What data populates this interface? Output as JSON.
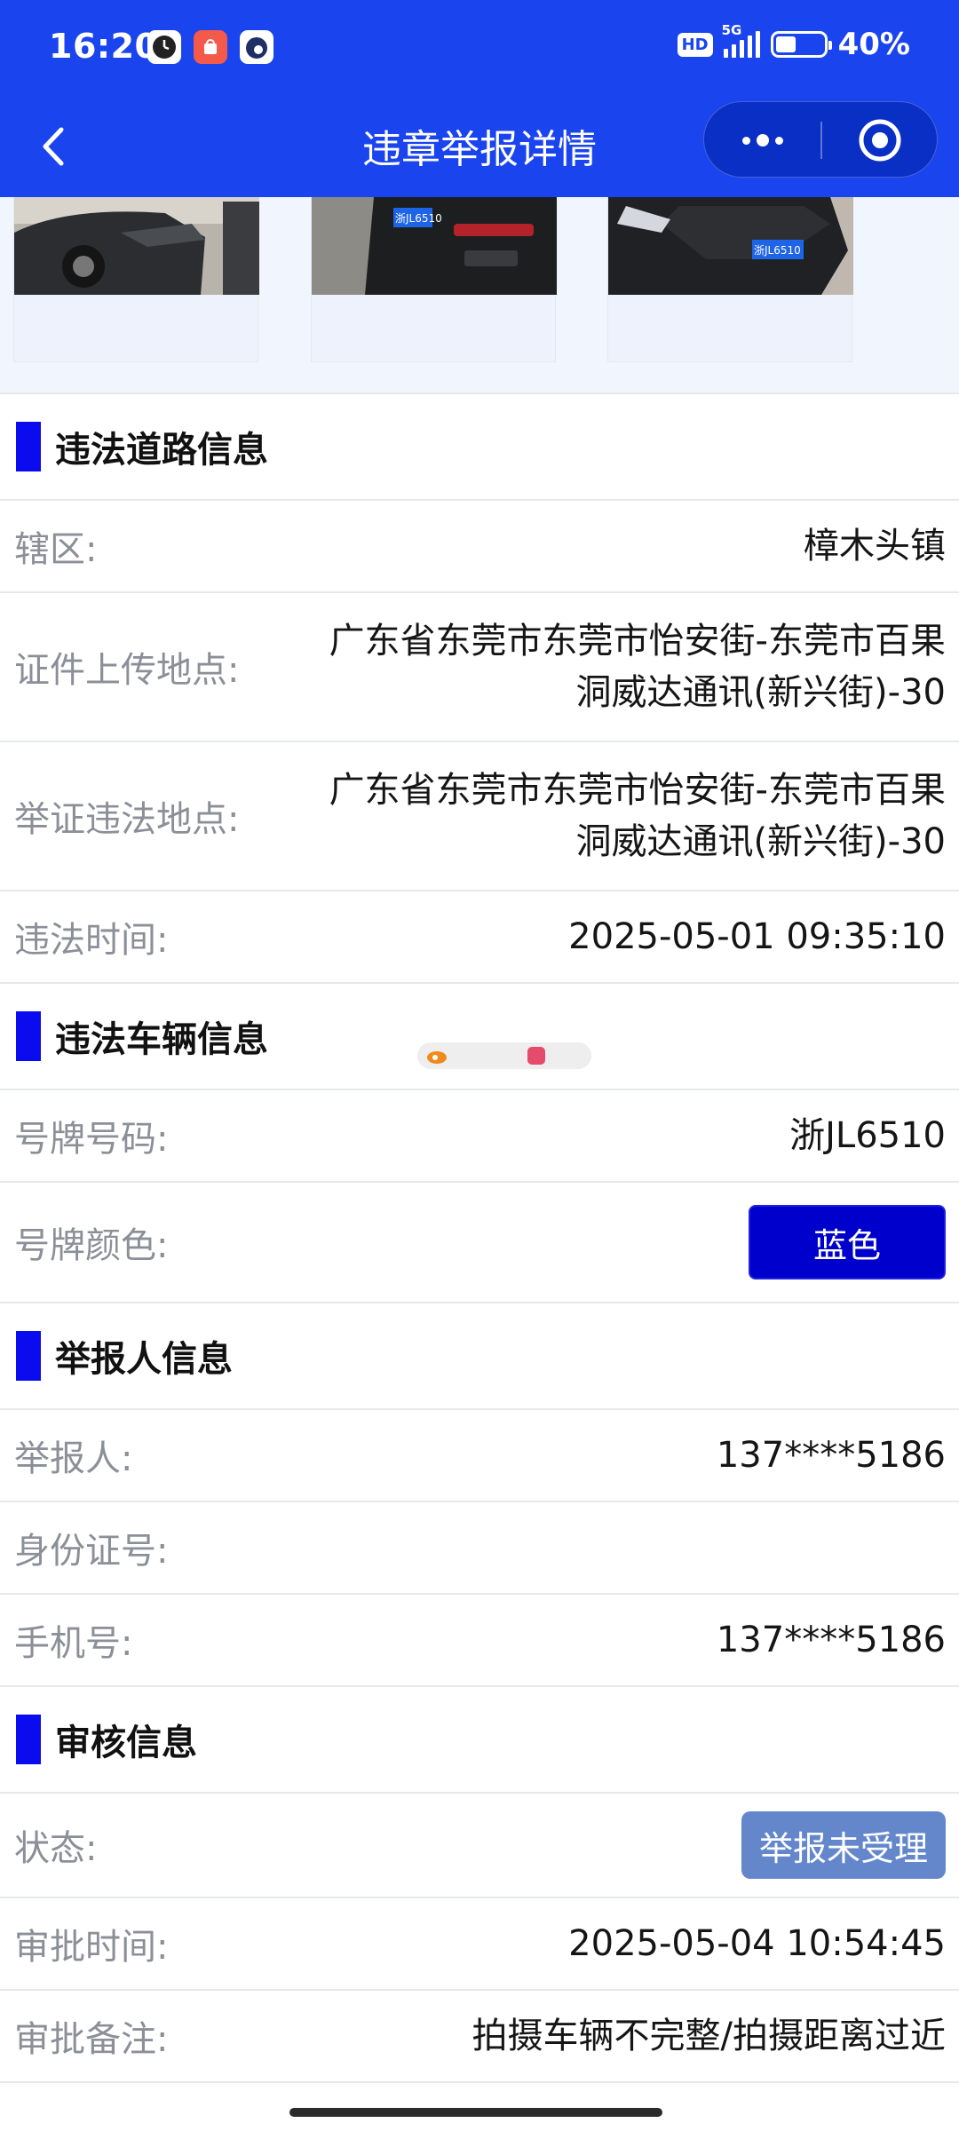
{
  "status_bar": {
    "time": "16:20",
    "hd": "HD",
    "network": "5G",
    "battery": "40%",
    "battery_level": 0.4
  },
  "nav": {
    "title": "违章举报详情"
  },
  "colors": {
    "brand_blue": "#1a44ee",
    "section_mark": "#0b0bf0",
    "plate_blue": "#0000cc",
    "status_badge": "#6487cc"
  },
  "photos": [
    {
      "plate_text": ""
    },
    {
      "plate_text": "浙JL6510"
    },
    {
      "plate_text": "浙JL6510"
    }
  ],
  "road_section": {
    "title": "违法道路信息",
    "district_label": "辖区:",
    "district_value": "樟木头镇",
    "upload_place_label": "证件上传地点:",
    "upload_place_value": "广东省东莞市东莞市怡安街-东莞市百果洞威达通讯(新兴街)-30",
    "violation_place_label": "举证违法地点:",
    "violation_place_value": "广东省东莞市东莞市怡安街-东莞市百果洞威达通讯(新兴街)-30",
    "violation_time_label": "违法时间:",
    "violation_time_value": "2025-05-01 09:35:10"
  },
  "vehicle_section": {
    "title": "违法车辆信息",
    "plate_no_label": "号牌号码:",
    "plate_no_value": "浙JL6510",
    "plate_color_label": "号牌颜色:",
    "plate_color_value": "蓝色"
  },
  "reporter_section": {
    "title": "举报人信息",
    "reporter_label": "举报人:",
    "reporter_value": "137****5186",
    "id_label": "身份证号:",
    "id_value": "",
    "phone_label": "手机号:",
    "phone_value": "137****5186"
  },
  "review_section": {
    "title": "审核信息",
    "status_label": "状态:",
    "status_value": "举报未受理",
    "review_time_label": "审批时间:",
    "review_time_value": "2025-05-04 10:54:45",
    "review_note_label": "审批备注:",
    "review_note_value": "拍摄车辆不完整/拍摄距离过近"
  }
}
